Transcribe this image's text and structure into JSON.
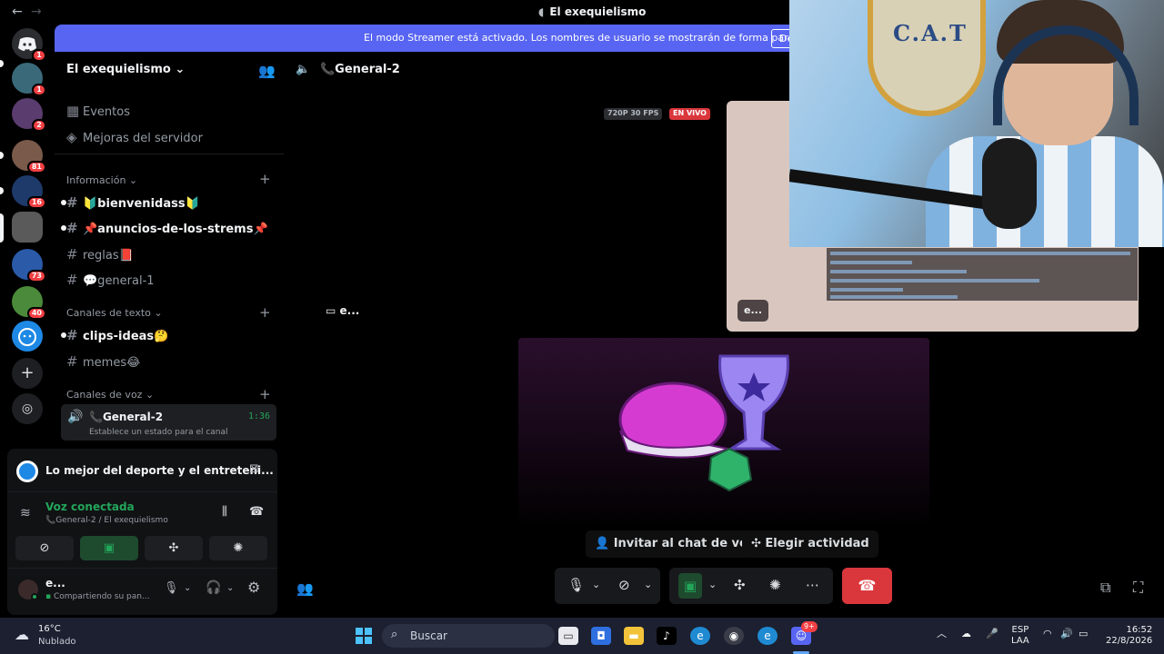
{
  "window": {
    "title": "El exequielismo",
    "nav_back": "←",
    "nav_forward": "→"
  },
  "rail": {
    "servers": [
      {
        "name": "direct-messages",
        "badge": "1",
        "color": "#2b2d31"
      },
      {
        "name": "server-2",
        "badge": "1",
        "color": "#3a6a7a"
      },
      {
        "name": "server-3",
        "badge": "2",
        "color": "#5a3c6e"
      },
      {
        "name": "server-4",
        "badge": "81",
        "color": "#7a5a4a"
      },
      {
        "name": "server-5",
        "badge": "16",
        "color": "#1e3a6a"
      },
      {
        "name": "server-6",
        "badge": "",
        "color": "#5a5a5a"
      },
      {
        "name": "server-7",
        "badge": "73",
        "color": "#2a5aa8"
      },
      {
        "name": "server-8",
        "badge": "40",
        "color": "#4a8a3a"
      },
      {
        "name": "server-9",
        "badge": "",
        "color": "#1e88e5"
      }
    ]
  },
  "banner": {
    "text": "El modo Streamer está activado. Los nombres de usuario se mostrarán de forma parcial.",
    "button": "De"
  },
  "sidebar": {
    "server_name": "El exequielismo",
    "chevron": "⌄",
    "events": "Eventos",
    "boosts": "Mejoras del servidor",
    "categories": {
      "info": "Información",
      "text": "Canales de texto",
      "voice": "Canales de voz"
    },
    "channels_info": [
      {
        "label": "🔰bienvenidass🔰",
        "unread": true
      },
      {
        "label": "📌anuncios-de-los-strems📌",
        "unread": true
      },
      {
        "label": "reglas📕",
        "unread": false
      },
      {
        "label": "💬general-1",
        "unread": false
      }
    ],
    "channels_text": [
      {
        "label": "clips-ideas🤔",
        "unread": true
      },
      {
        "label": "memes😂",
        "unread": false
      }
    ],
    "voice_channel": {
      "label": "📞General-2",
      "timer": "1:36",
      "status": "Establece un estado para el canal"
    }
  },
  "panel": {
    "promo_text": "Lo mejor del deporte y el entreteni...",
    "voice_connected": "Voz conectada",
    "voice_location": "📞General-2 / El exequielismo",
    "user_name": "e...",
    "user_status": "Compartiendo su pan..."
  },
  "stage": {
    "channel_name": "📞General-2",
    "quality_tag": "720P 30 FPS",
    "live_tag": "EN VIVO",
    "participant_label": "e...",
    "stream_user_label": "e...",
    "invite_button": "Invitar al chat de voz",
    "activity_button": "Elegir actividad"
  },
  "webcam": {
    "crest_text": "C.A.T"
  },
  "taskbar": {
    "weather_temp": "16°C",
    "weather_desc": "Nublado",
    "search_placeholder": "Buscar",
    "lang": "ESP",
    "layout": "LAA",
    "time": "16:52",
    "date": "22/8/2026",
    "discord_badge": "9+"
  },
  "colors": {
    "blurple": "#5865f2",
    "green": "#23a55a",
    "red": "#da373c"
  }
}
